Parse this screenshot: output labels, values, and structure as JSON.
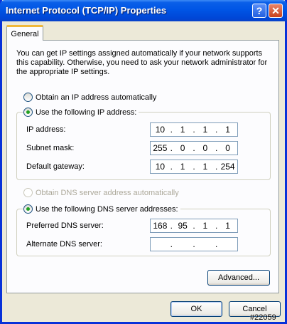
{
  "window": {
    "title": "Internet Protocol (TCP/IP) Properties",
    "help_glyph": "?",
    "close_glyph": "✕"
  },
  "tabs": [
    {
      "label": "General",
      "selected": true
    }
  ],
  "intro_lines": [
    "You can get IP settings assigned automatically if your network supports",
    "this capability. Otherwise, you need to ask your network administrator for",
    "the appropriate IP settings."
  ],
  "ip": {
    "auto_radio": {
      "label": "Obtain an IP address automatically",
      "checked": false
    },
    "manual_radio": {
      "label": "Use the following IP address:",
      "checked": true
    },
    "fields": [
      {
        "label": "IP address:",
        "octets": [
          "10",
          "1",
          "1",
          "1"
        ]
      },
      {
        "label": "Subnet mask:",
        "octets": [
          "255",
          "0",
          "0",
          "0"
        ]
      },
      {
        "label": "Default gateway:",
        "octets": [
          "10",
          "1",
          "1",
          "254"
        ]
      }
    ]
  },
  "dns": {
    "auto_radio": {
      "label": "Obtain DNS server address automatically",
      "checked": false,
      "disabled": true
    },
    "manual_radio": {
      "label": "Use the following DNS server addresses:",
      "checked": true
    },
    "fields": [
      {
        "label": "Preferred DNS server:",
        "octets": [
          "168",
          "95",
          "1",
          "1"
        ]
      },
      {
        "label": "Alternate DNS server:",
        "octets": [
          "",
          "",
          "",
          ""
        ]
      }
    ]
  },
  "buttons": {
    "advanced": "Advanced...",
    "ok": "OK",
    "cancel": "Cancel"
  },
  "watermark": "#22059",
  "colors": {
    "title_bar": "#0055e5",
    "dialog_bg": "#ece9d8",
    "radio_dot": "#21a121",
    "tab_highlight": "#f0b83a"
  }
}
